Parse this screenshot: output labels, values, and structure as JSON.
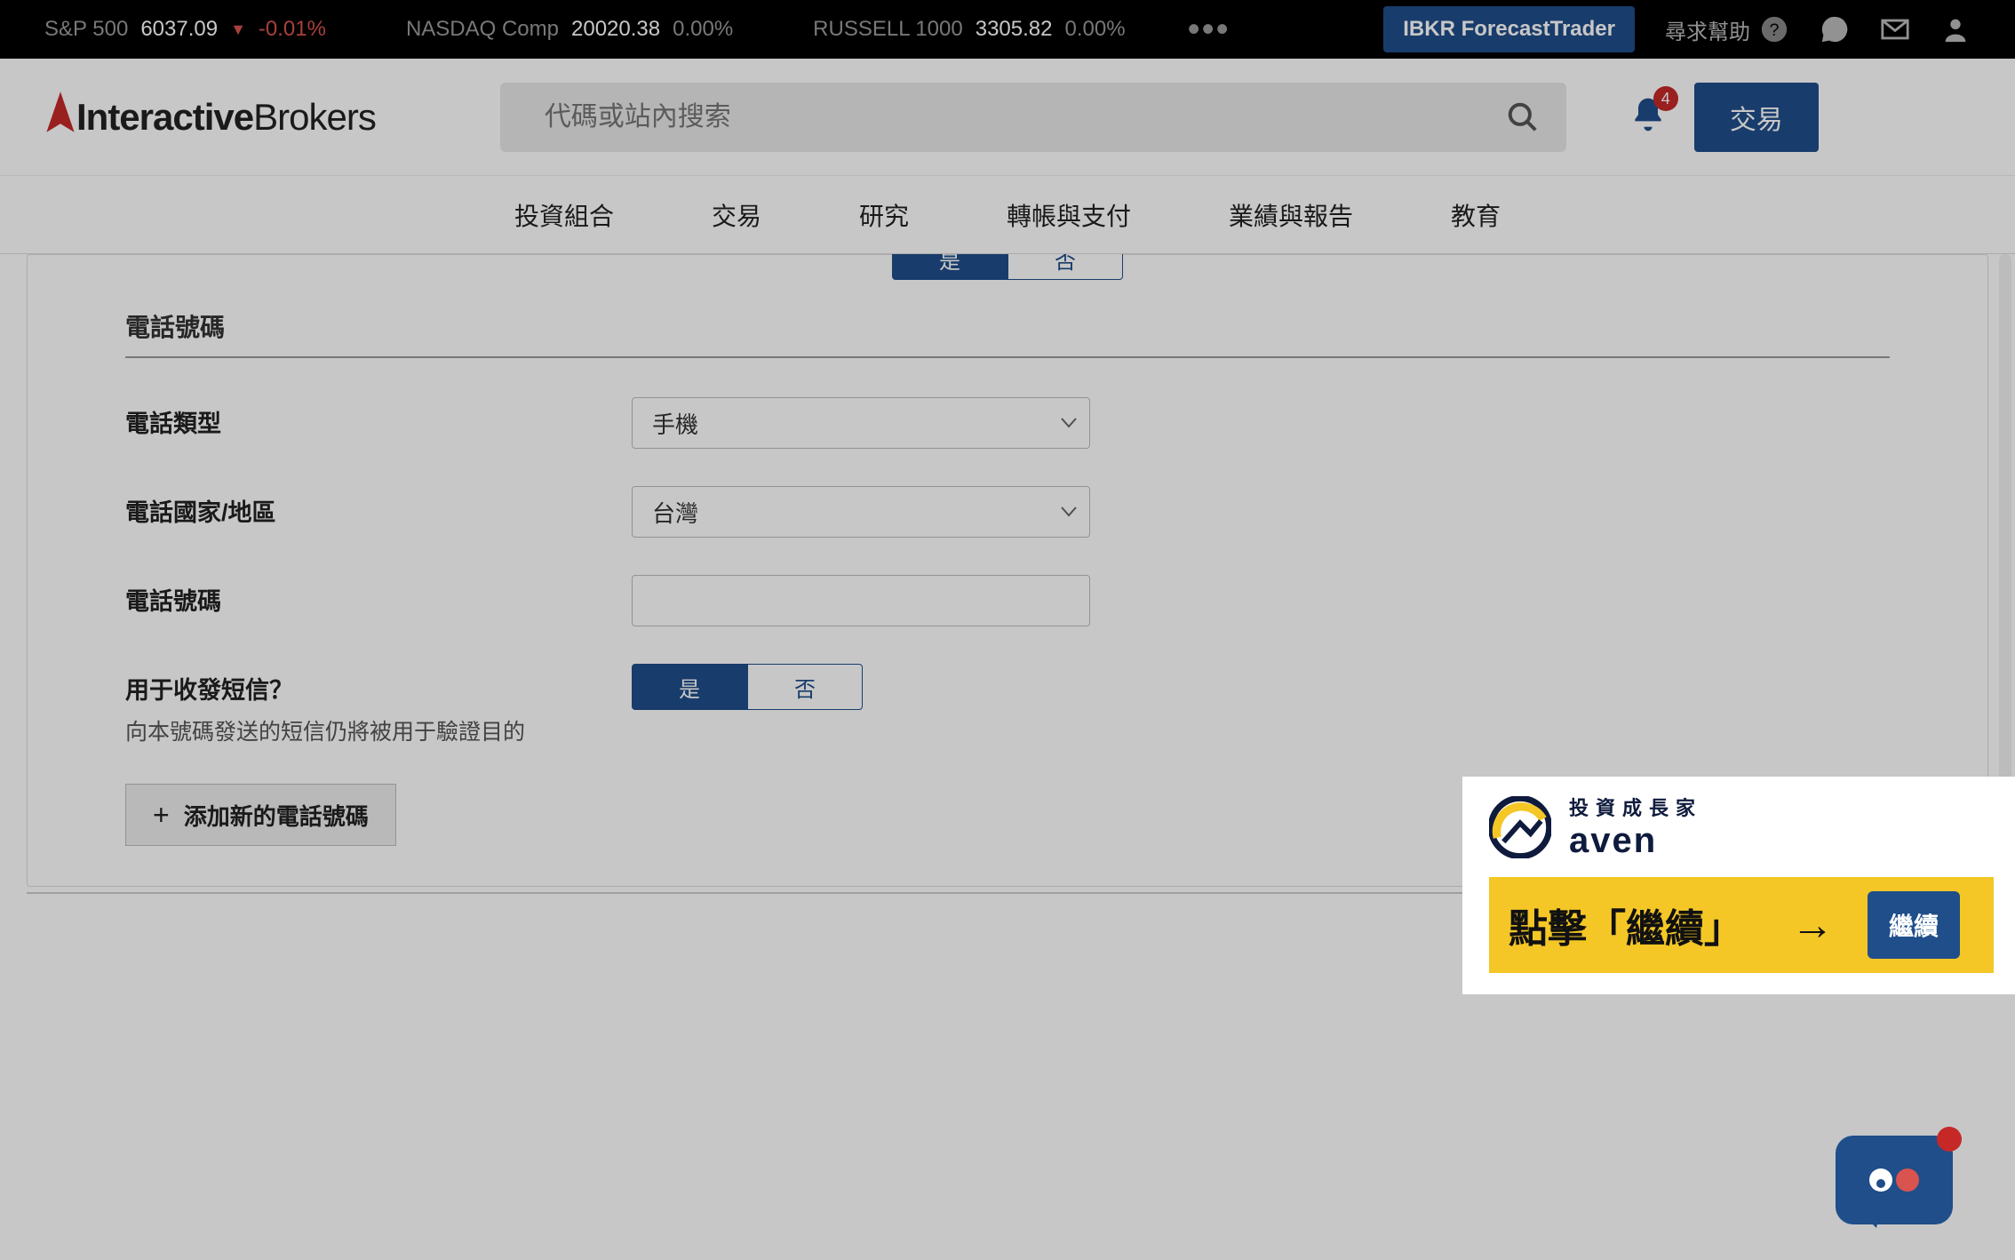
{
  "ticker": {
    "sp500": {
      "label": "S&P 500",
      "value": "6037.09",
      "change": "-0.01%"
    },
    "nasdaq": {
      "label": "NASDAQ Comp",
      "value": "20020.38",
      "change": "0.00%"
    },
    "russell": {
      "label": "RUSSELL 1000",
      "value": "3305.82",
      "change": "0.00%"
    },
    "more": "•••",
    "forecast_btn": "IBKR ForecastTrader",
    "help": "尋求幫助"
  },
  "header": {
    "logo_main": "Interactive",
    "logo_sub": "Brokers",
    "search_placeholder": "代碼或站內搜索",
    "notification_count": "4",
    "trade_btn": "交易"
  },
  "nav": {
    "portfolio": "投資組合",
    "trade": "交易",
    "research": "研究",
    "transfer": "轉帳與支付",
    "reports": "業績與報告",
    "education": "教育"
  },
  "form": {
    "top_seg_yes": "是",
    "top_seg_no": "否",
    "section_title": "電話號碼",
    "phone_type_label": "電話類型",
    "phone_type_value": "手機",
    "phone_country_label": "電話國家/地區",
    "phone_country_value": "台灣",
    "phone_number_label": "電話號碼",
    "sms_label": "用于收發短信？",
    "sms_sublabel": "向本號碼發送的短信仍將被用于驗證目的",
    "sms_yes": "是",
    "sms_no": "否",
    "add_btn": "添加新的電話號碼"
  },
  "cta": {
    "brand_top": "投資成長家",
    "brand_bottom": "aven",
    "text": "點擊「繼續」",
    "arrow": "→",
    "button": "繼續"
  }
}
